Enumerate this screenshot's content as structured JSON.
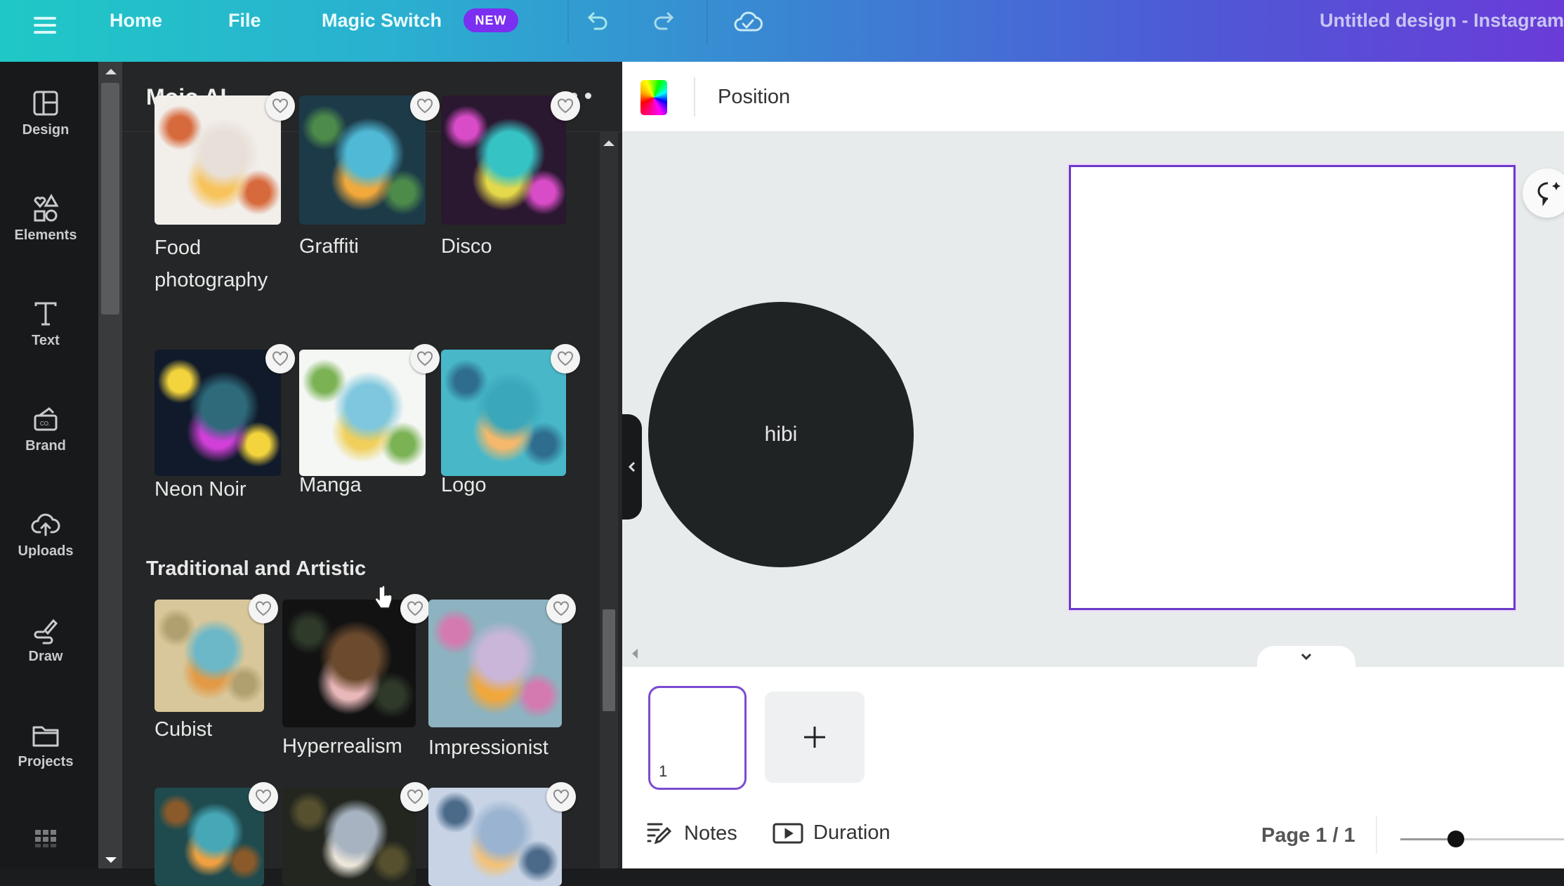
{
  "topbar": {
    "menu_icon": "hamburger-menu-icon",
    "nav": [
      "Home",
      "File",
      "Magic Switch"
    ],
    "new_badge": "NEW",
    "undo_icon": "undo-icon",
    "redo_icon": "redo-icon",
    "save_status_icon": "cloud-check-icon",
    "document_title": "Untitled design - Instagram"
  },
  "rail": {
    "items": [
      {
        "label": "Design",
        "icon": "layout-icon"
      },
      {
        "label": "Elements",
        "icon": "shapes-icon"
      },
      {
        "label": "Text",
        "icon": "text-icon"
      },
      {
        "label": "Brand",
        "icon": "brand-kit-icon"
      },
      {
        "label": "Uploads",
        "icon": "cloud-upload-icon"
      },
      {
        "label": "Draw",
        "icon": "draw-icon"
      },
      {
        "label": "Projects",
        "icon": "folder-icon"
      }
    ],
    "apps_icon": "apps-grid-icon"
  },
  "panel": {
    "title": "Mojo AI",
    "more_icon": "more-horizontal-icon",
    "styles_row1": [
      {
        "name": "Food photography",
        "colors": [
          "#f2eeea",
          "#e8e0d8",
          "#f7c35a",
          "#d76a3c"
        ]
      },
      {
        "name": "Graffiti",
        "colors": [
          "#1d3a48",
          "#4fb9d6",
          "#f2a93b",
          "#4c8b4a"
        ]
      },
      {
        "name": "Disco",
        "colors": [
          "#2a1730",
          "#36c3c4",
          "#e5d84a",
          "#d94cc8"
        ]
      }
    ],
    "styles_row2": [
      {
        "name": "Neon Noir",
        "colors": [
          "#101a2a",
          "#2e6a7a",
          "#d13fd8",
          "#f3d43c"
        ]
      },
      {
        "name": "Manga",
        "colors": [
          "#f4f7f4",
          "#7fc7de",
          "#f0cf5a",
          "#7ab254"
        ]
      },
      {
        "name": "Logo",
        "colors": [
          "#48b8c9",
          "#3aa7ba",
          "#f6b86a",
          "#2f6d8f"
        ]
      }
    ],
    "section_title": "Traditional and Artistic",
    "styles_row3": [
      {
        "name": "Cubist",
        "colors": [
          "#d8c79a",
          "#6cb7c8",
          "#e39a46",
          "#b0a070"
        ]
      },
      {
        "name": "Hyperrealism",
        "colors": [
          "#121212",
          "#6b4a2e",
          "#e8b7b9",
          "#2f3a2a"
        ]
      },
      {
        "name": "Impressionist",
        "colors": [
          "#8db2c0",
          "#c9b6d8",
          "#f0a83d",
          "#d57ab0"
        ]
      }
    ],
    "styles_row4": [
      {
        "name": "",
        "colors": [
          "#1f4b4f",
          "#46a7b7",
          "#f0a040",
          "#8a5a2a"
        ]
      },
      {
        "name": "",
        "colors": [
          "#22261f",
          "#a7b3c0",
          "#ece6da",
          "#56502e"
        ]
      },
      {
        "name": "",
        "colors": [
          "#c8d4e6",
          "#9ab3d0",
          "#f3c27a",
          "#4b6a8a"
        ]
      }
    ],
    "favorite_icon": "heart-icon"
  },
  "toolbar": {
    "color_icon": "color-picker-icon",
    "position_label": "Position"
  },
  "canvas": {
    "circle_text": "hibi",
    "circle_color": "#202324",
    "page_border_color": "#6a3bc8",
    "ai_button_icon": "ai-chat-icon",
    "collapse_icon": "chevron-left-icon",
    "expand_icon": "chevron-down-icon"
  },
  "bottom": {
    "page_thumb_number": "1",
    "add_page_icon": "plus-icon",
    "notes_label": "Notes",
    "duration_label": "Duration",
    "page_indicator": "Page 1 / 1",
    "zoom_level_fraction": 0.33
  }
}
